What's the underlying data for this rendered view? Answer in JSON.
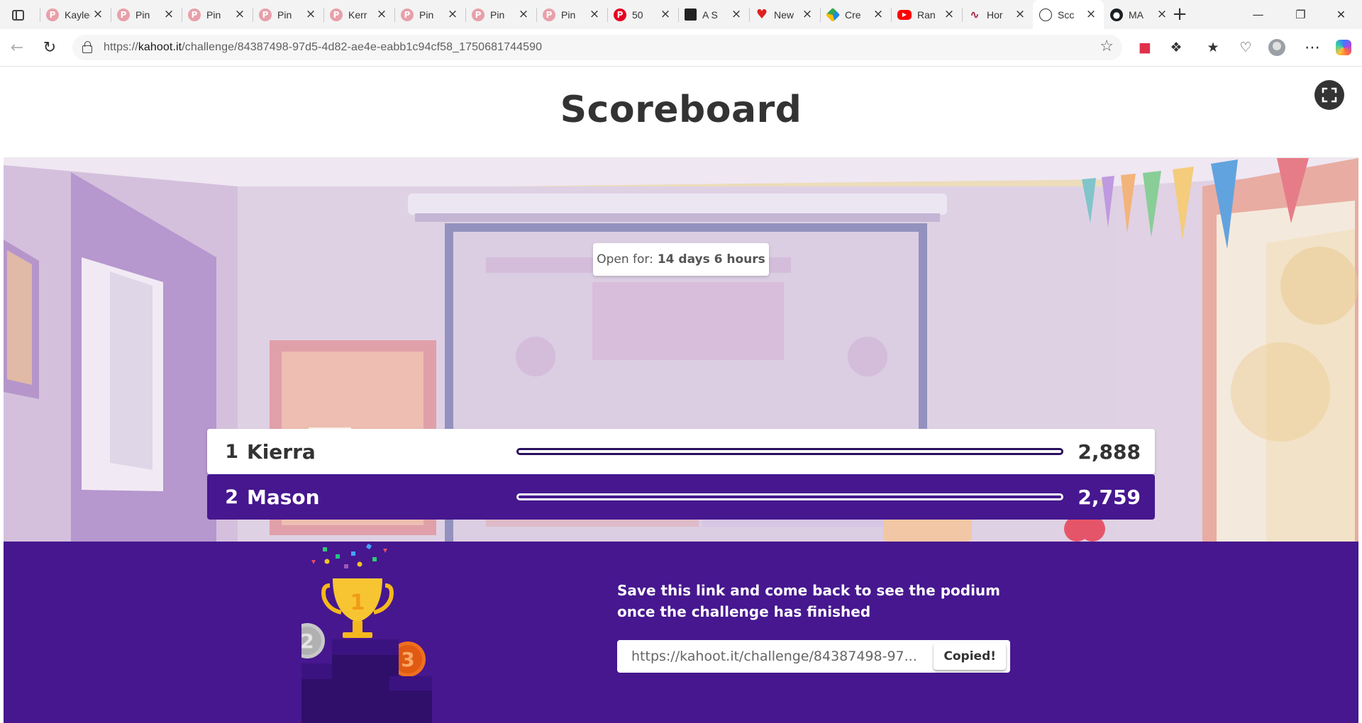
{
  "browser": {
    "tabs": [
      {
        "title": "Kaylee",
        "icon": "pinterest-icon"
      },
      {
        "title": "Pin",
        "icon": "pinterest-icon"
      },
      {
        "title": "Pin",
        "icon": "pinterest-icon"
      },
      {
        "title": "Pin",
        "icon": "pinterest-icon"
      },
      {
        "title": "Kerr",
        "icon": "pinterest-icon"
      },
      {
        "title": "Pin",
        "icon": "pinterest-icon"
      },
      {
        "title": "Pin",
        "icon": "pinterest-icon"
      },
      {
        "title": "Pin",
        "icon": "pinterest-icon"
      },
      {
        "title": "50",
        "icon": "pinterest-icon"
      },
      {
        "title": "A S",
        "icon": "qr-code-icon"
      },
      {
        "title": "New",
        "icon": "heart-icon"
      },
      {
        "title": "Cre",
        "icon": "drive-icon"
      },
      {
        "title": "Ran",
        "icon": "youtube-icon"
      },
      {
        "title": "Hor",
        "icon": "wave-icon"
      },
      {
        "title": "Scc",
        "icon": "globe-icon"
      },
      {
        "title": "MA",
        "icon": "github-icon"
      }
    ],
    "url_domain": "kahoot.it",
    "url_prefix": "https://",
    "url_path": "/challenge/84387498-97d5-4d82-ae4e-eabb1c94cf58_1750681744590"
  },
  "page": {
    "title": "Scoreboard",
    "timer_label": "Open for:",
    "timer_value": "14 days 6 hours",
    "colors": {
      "brand_purple": "#46178f",
      "header_text": "#333333"
    }
  },
  "scoreboard": {
    "players": [
      {
        "rank": "1",
        "name": "Kierra",
        "score": "2,888"
      },
      {
        "rank": "2",
        "name": "Mason",
        "score": "2,759"
      }
    ]
  },
  "footer": {
    "message": "Save this link and come back to see the podium once the challenge has finished",
    "link": "https://kahoot.it/challenge/84387498-97...",
    "copy_label": "Copied!",
    "podium_places": [
      "1",
      "2",
      "3"
    ]
  }
}
